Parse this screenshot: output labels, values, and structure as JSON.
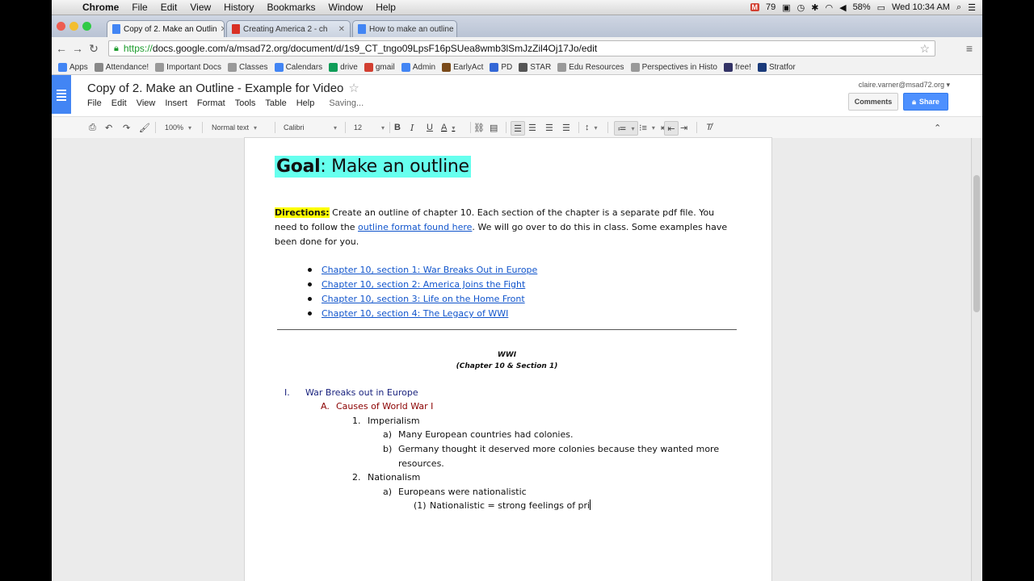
{
  "menubar": {
    "app": "Chrome",
    "items": [
      "File",
      "Edit",
      "View",
      "History",
      "Bookmarks",
      "Window",
      "Help"
    ],
    "mail_count": "79",
    "battery": "58%",
    "clock": "Wed 10:34 AM"
  },
  "tabs": [
    {
      "label": "Copy of 2. Make an Outlin",
      "active": true,
      "color": "#4285f4"
    },
    {
      "label": "Creating America 2 - ch",
      "active": false,
      "color": "#d93025"
    },
    {
      "label": "How to make an outline",
      "active": false,
      "color": "#4285f4"
    }
  ],
  "address": {
    "scheme": "https://",
    "rest": "docs.google.com/a/msad72.org/document/d/1s9_CT_tngo09LpsF16pSUea8wmb3lSmJzZil4Oj17Jo/edit"
  },
  "bookmarks": [
    {
      "label": "Apps",
      "color": "#4285f4"
    },
    {
      "label": "Attendance!",
      "color": "#888888"
    },
    {
      "label": "Important Docs",
      "color": "#999999"
    },
    {
      "label": "Classes",
      "color": "#999999"
    },
    {
      "label": "Calendars",
      "color": "#4285f4"
    },
    {
      "label": "drive",
      "color": "#0f9d58"
    },
    {
      "label": "gmail",
      "color": "#d23f31"
    },
    {
      "label": "Admin",
      "color": "#4285f4"
    },
    {
      "label": "EarlyAct",
      "color": "#7a4a1a"
    },
    {
      "label": "PD",
      "color": "#3367d6"
    },
    {
      "label": "STAR",
      "color": "#555555"
    },
    {
      "label": "Edu Resources",
      "color": "#999999"
    },
    {
      "label": "Perspectives in Histo",
      "color": "#999999"
    },
    {
      "label": "free!",
      "color": "#333366"
    },
    {
      "label": "Stratfor",
      "color": "#1a3a7a"
    }
  ],
  "docs": {
    "title": "Copy of 2. Make an Outline - Example for Video",
    "menu": [
      "File",
      "Edit",
      "View",
      "Insert",
      "Format",
      "Tools",
      "Table",
      "Help"
    ],
    "status": "Saving...",
    "user": "claire.varner@msad72.org",
    "comments": "Comments",
    "share": "Share"
  },
  "format": {
    "zoom": "100%",
    "style": "Normal text",
    "font": "Calibri",
    "size": "12"
  },
  "doc": {
    "goal_bold": "Goal",
    "goal_rest": ":  Make an outline",
    "directions_label": "Directions:",
    "directions_text1": " Create an outline of chapter 10.  Each section of the chapter is a separate pdf file.  You need to follow the ",
    "directions_link": "outline format found here",
    "directions_text2": ".  We will go over to do this in class.  Some examples have been done for you.",
    "chapters": [
      "Chapter 10, section 1: War Breaks Out in Europe",
      "Chapter 10, section 2: America Joins the Fight",
      "Chapter 10, section 3: Life on the Home Front",
      "Chapter 10, section 4: The Legacy of WWI"
    ],
    "wwi_title": "WWI",
    "wwi_sub": "(Chapter 10 & Section 1)",
    "outline": {
      "i_num": "I.",
      "i_text": "War Breaks out in Europe",
      "a_num": "A.",
      "a_text": "Causes of World War I",
      "n1": "1.",
      "n1_text": "Imperialism",
      "a1": "a)",
      "a1_text": "Many European countries had colonies.",
      "b1": "b)",
      "b1_text1": "Germany thought it deserved more colonies because they wanted more",
      "b1_text2": "resources.",
      "n2": "2.",
      "n2_text": "Nationalism",
      "a2": "a)",
      "a2_text": "Europeans were nationalistic",
      "p1": "(1)",
      "p1_text": "Nationalistic = strong feelings of pri"
    }
  }
}
